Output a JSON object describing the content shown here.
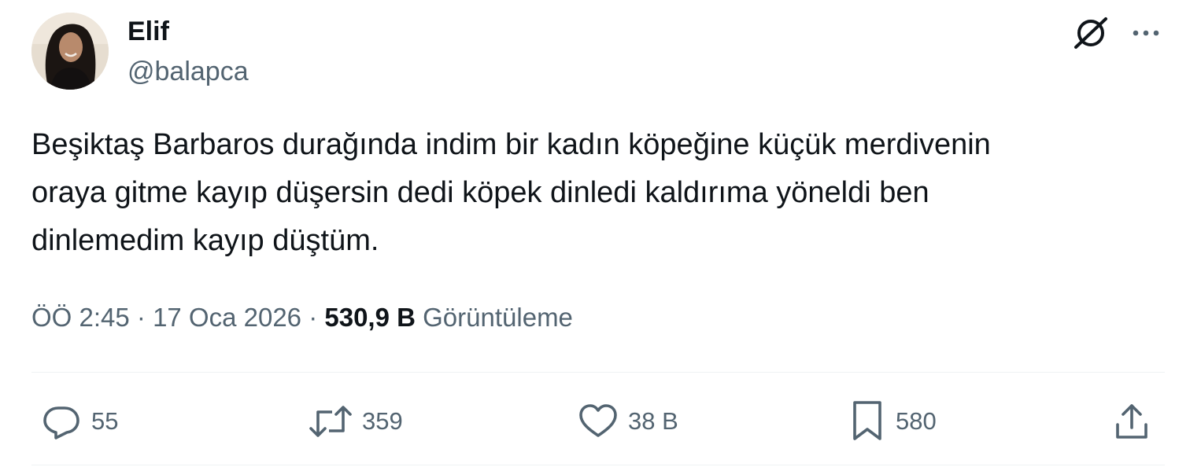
{
  "author": {
    "display_name": "Elif",
    "handle": "@balapca"
  },
  "tweet": {
    "text": "Beşiktaş Barbaros durağında indim bir kadın köpeğine küçük merdivenin\noraya gitme kayıp düşersin dedi köpek dinledi kaldırıma yöneldi ben\ndinlemedim kayıp düştüm."
  },
  "meta": {
    "time": "ÖÖ 2:45",
    "separator": " · ",
    "date": "17 Oca 2026",
    "views_count": "530,9 B",
    "views_label": "Görüntüleme"
  },
  "actions": {
    "reply_count": "55",
    "repost_count": "359",
    "like_count": "38 B",
    "bookmark_count": "580"
  },
  "icons": {
    "grok": "grok-icon",
    "more": "more-icon",
    "reply": "reply-icon",
    "repost": "repost-icon",
    "like": "heart-icon",
    "bookmark": "bookmark-icon",
    "share": "share-icon"
  },
  "colors": {
    "text_primary": "#0f1419",
    "text_secondary": "#536471",
    "divider": "#eff3f4"
  }
}
